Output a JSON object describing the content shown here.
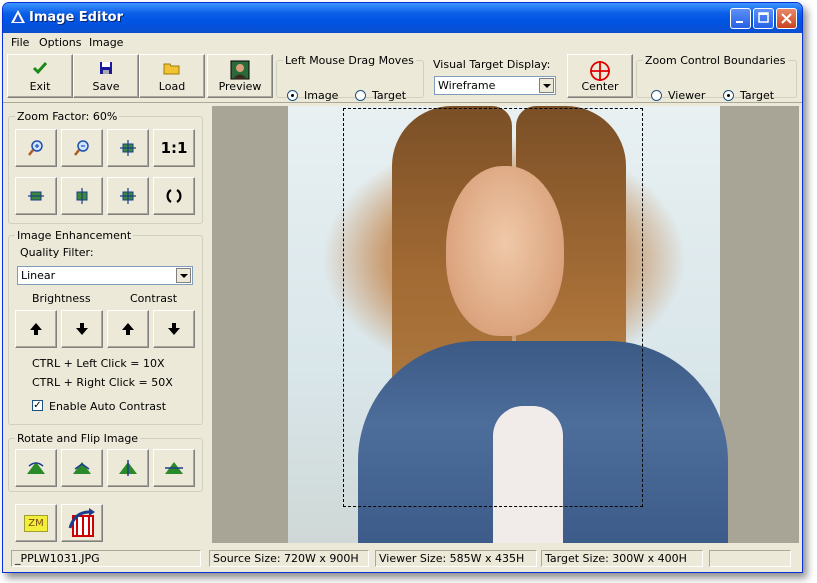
{
  "window": {
    "title": "Image Editor"
  },
  "menu": [
    "File",
    "Options",
    "Image"
  ],
  "toolbar": {
    "exit_label": "Exit",
    "save_label": "Save",
    "load_label": "Load",
    "preview_label": "Preview",
    "center_label": "Center"
  },
  "drag": {
    "legend": "Left Mouse Drag Moves",
    "options": [
      "Image",
      "Target"
    ],
    "selected": "Image"
  },
  "visual_target": {
    "label": "Visual Target Display:",
    "value": "Wireframe"
  },
  "zoom_bounds": {
    "legend": "Zoom Control Boundaries",
    "options": [
      "Viewer",
      "Target"
    ],
    "selected": "Target"
  },
  "zoom": {
    "legend": "Zoom Factor: 60%",
    "one_to_one": "1:1"
  },
  "enhance": {
    "legend": "Image Enhancement",
    "quality_label": "Quality Filter:",
    "quality_value": "Linear",
    "brightness_label": "Brightness",
    "contrast_label": "Contrast",
    "hint1": "CTRL + Left Click = 10X",
    "hint2": "CTRL + Right Click = 50X",
    "auto_contrast": "Enable Auto Contrast",
    "auto_contrast_checked": true
  },
  "rotate": {
    "legend": "Rotate and Flip Image"
  },
  "bottom": {
    "zm_label": "ZM"
  },
  "status": {
    "file": "_PPLW1031.JPG",
    "source": "Source Size: 720W x 900H",
    "viewer": "Viewer Size: 585W x 435H",
    "target": "Target Size: 300W x 400H",
    "extra": ""
  },
  "colors": {
    "accent": "#0054e3",
    "center_icon": "#e00000",
    "exit_icon": "#1a8a1a",
    "save_icon": "#1a1a9a"
  }
}
